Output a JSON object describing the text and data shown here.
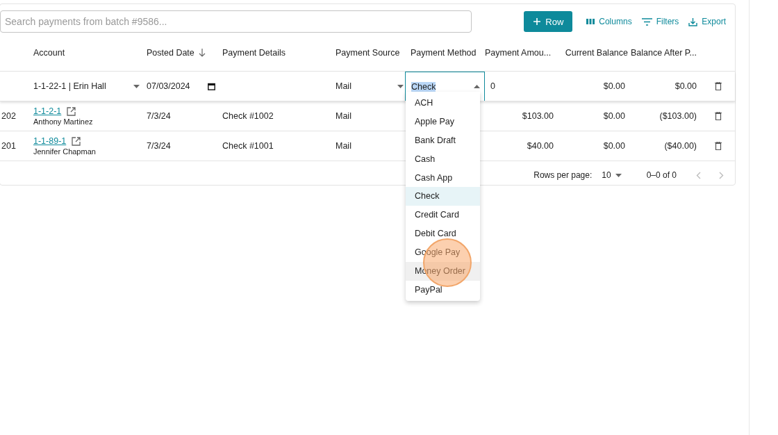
{
  "search": {
    "placeholder": "Search payments from batch #9586..."
  },
  "toolbar": [
    {
      "kind": "add",
      "label": "Row"
    },
    {
      "kind": "columns",
      "label": "Columns"
    },
    {
      "kind": "filters",
      "label": "Filters"
    },
    {
      "kind": "export",
      "label": "Export"
    }
  ],
  "table": {
    "columns": [
      {},
      {
        "label": "Account"
      },
      {
        "label": "Posted Date",
        "sorted": true
      },
      {
        "label": "Payment Details"
      },
      {
        "label": "Payment Source"
      },
      {
        "label": "Payment Method"
      },
      {
        "label": "Payment Amou..."
      },
      {
        "label": "Current Balance"
      },
      {
        "label": "Balance After P..."
      }
    ],
    "edit_row": {
      "account": "1-1-22-1 | Erin Hall",
      "date": "07/03/2024",
      "source": "Mail",
      "method": "Check",
      "amount": "0",
      "current_balance": "$0.00",
      "balance_after": "$0.00"
    },
    "rows": [
      {
        "id": "202",
        "account": "1-1-2-1",
        "name": "Anthony Martinez",
        "date": "7/3/24",
        "details": "Check #1002",
        "source": "Mail",
        "amount": "$103.00",
        "current_balance": "$0.00",
        "balance_after": "($103.00)"
      },
      {
        "id": "201",
        "account": "1-1-89-1",
        "name": "Jennifer Chapman",
        "date": "7/3/24",
        "details": "Check #1001",
        "source": "Mail",
        "amount": "$40.00",
        "current_balance": "$0.00",
        "balance_after": "($40.00)"
      }
    ]
  },
  "pagination": {
    "label": "Rows per page:",
    "page_size": "10",
    "range": "0–0 of 0"
  },
  "dropdown": {
    "options": [
      {
        "label": "ACH",
        "selected": false,
        "hovered": false
      },
      {
        "label": "Apple Pay",
        "selected": false,
        "hovered": false
      },
      {
        "label": "Bank Draft",
        "selected": false,
        "hovered": false
      },
      {
        "label": "Cash",
        "selected": false,
        "hovered": false
      },
      {
        "label": "Cash App",
        "selected": false,
        "hovered": false
      },
      {
        "label": "Check",
        "selected": true,
        "hovered": false
      },
      {
        "label": "Credit Card",
        "selected": false,
        "hovered": false
      },
      {
        "label": "Debit Card",
        "selected": false,
        "hovered": false
      },
      {
        "label": "Google Pay",
        "selected": false,
        "hovered": false
      },
      {
        "label": "Money Order",
        "selected": false,
        "hovered": true
      },
      {
        "label": "PayPal",
        "selected": false,
        "hovered": false
      }
    ]
  }
}
